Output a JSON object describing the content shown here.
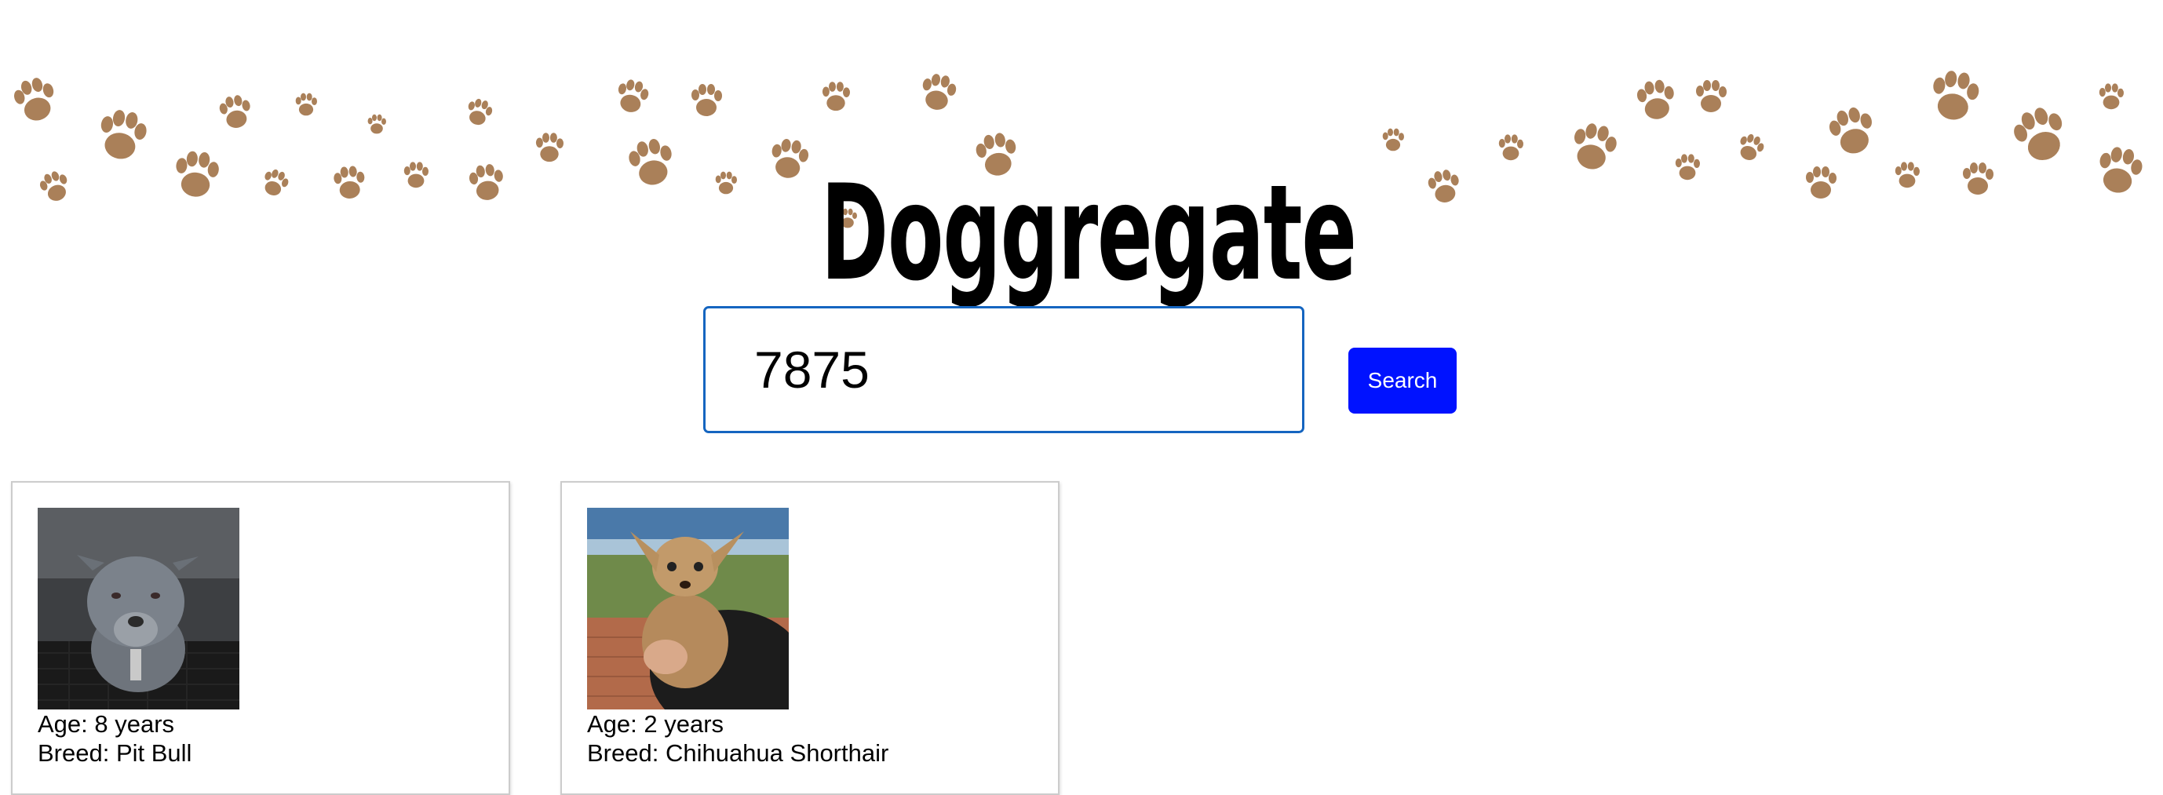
{
  "header": {
    "title": "Doggregate"
  },
  "search": {
    "value": "7875",
    "button_label": "Search"
  },
  "results": [
    {
      "age": "Age: 8 years",
      "breed": "Breed: Pit Bull"
    },
    {
      "age": "Age: 2 years",
      "breed": "Breed: Chihuahua Shorthair"
    }
  ],
  "colors": {
    "accent_button": "#0012ff",
    "input_border": "#1565c0",
    "paw_brown": "#9b6a3c"
  }
}
